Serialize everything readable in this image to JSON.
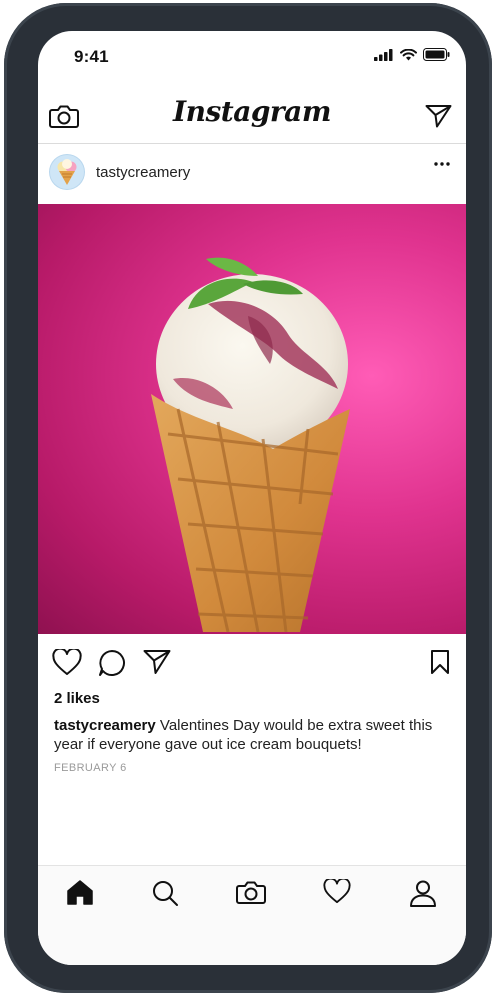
{
  "status_bar": {
    "time": "9:41"
  },
  "header": {
    "logo": "Instagram"
  },
  "post": {
    "username": "tastycreamery",
    "likes": "2 likes",
    "caption_user": "tastycreamery",
    "caption_text": "Valentines Day would be extra sweet this year if everyone gave out ice cream bouquets!",
    "date": "FEBRUARY 6"
  },
  "icons": {
    "header_left": "camera-icon",
    "header_right": "direct-message-icon",
    "actions": [
      "heart-icon",
      "comment-icon",
      "share-icon",
      "bookmark-icon"
    ],
    "tabs": [
      "home-icon",
      "search-icon",
      "camera-icon",
      "heart-icon",
      "profile-icon"
    ]
  },
  "colors": {
    "image_background": "#e0338f",
    "frame": "#2a3038"
  }
}
